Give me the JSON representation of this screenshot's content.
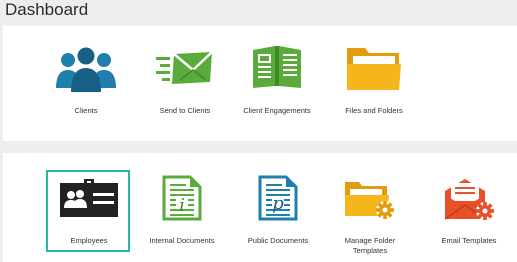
{
  "header": {
    "title": "Dashboard"
  },
  "top_tiles": [
    {
      "label": "Clients",
      "icon": "people-group-icon"
    },
    {
      "label": "Send to Clients",
      "icon": "send-envelope-icon"
    },
    {
      "label": "Client Engagements",
      "icon": "open-book-icon"
    },
    {
      "label": "Files and Folders",
      "icon": "folder-icon"
    }
  ],
  "bottom_tiles": [
    {
      "label": "Employees",
      "icon": "id-badge-icon",
      "selected": true
    },
    {
      "label": "Internal Documents",
      "icon": "internal-document-icon"
    },
    {
      "label": "Public Documents",
      "icon": "public-document-icon"
    },
    {
      "label": "Manage Folder Templates",
      "icon": "folder-gear-icon"
    },
    {
      "label": "Email Templates",
      "icon": "envelope-gear-icon"
    }
  ],
  "colors": {
    "selection_border": "#2bb5a3",
    "clients_blue": "#1f7fae",
    "green": "#5aaa3c",
    "folder_yellow": "#f6b51b",
    "email_orange": "#e8502a",
    "badge_dark": "#222222"
  }
}
